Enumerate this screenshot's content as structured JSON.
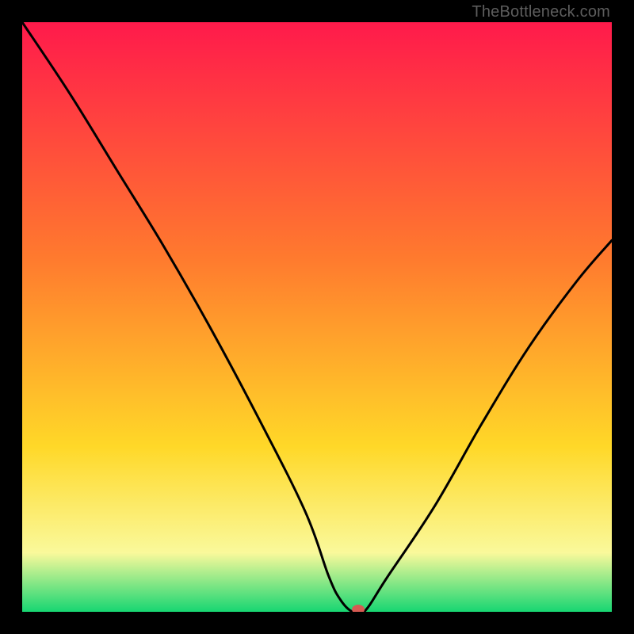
{
  "watermark": "TheBottleneck.com",
  "chart_data": {
    "type": "line",
    "title": "",
    "xlabel": "",
    "ylabel": "",
    "xlim": [
      0,
      100
    ],
    "ylim": [
      0,
      100
    ],
    "grid": false,
    "legend": false,
    "series": [
      {
        "name": "bottleneck-curve",
        "x": [
          0,
          8,
          16,
          24,
          32,
          40,
          48,
          52,
          54,
          56,
          58,
          62,
          70,
          78,
          86,
          94,
          100
        ],
        "values": [
          100,
          88,
          75,
          62,
          48,
          33,
          17,
          6,
          2,
          0,
          0,
          6,
          18,
          32,
          45,
          56,
          63
        ]
      }
    ],
    "marker": {
      "name": "optimum-point",
      "x": 57,
      "y": 0,
      "color": "#d65a52"
    },
    "background_gradient": {
      "top": "#ff1a4b",
      "mid1": "#ff7a2e",
      "mid2": "#ffd828",
      "mid3": "#faf99b",
      "bottom": "#17d672"
    }
  }
}
